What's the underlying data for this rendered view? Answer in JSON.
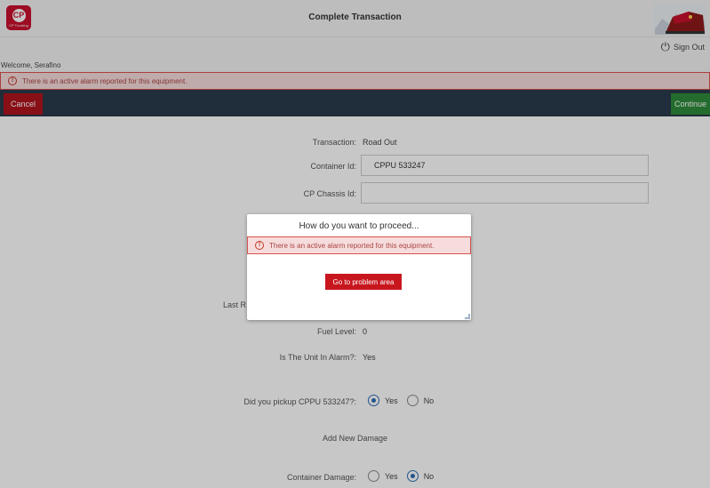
{
  "header": {
    "title": "Complete Transaction",
    "logo_text": "CP",
    "logo_subtext": "CP Trucking",
    "sign_out_label": "Sign Out"
  },
  "welcome_text": "Welcome, Serafino",
  "alert": {
    "message": "There is an active alarm reported for this equipment."
  },
  "actions": {
    "cancel_label": "Cancel",
    "continue_label": "Continue"
  },
  "form": {
    "transaction_label": "Transaction:",
    "transaction_value": "Road Out",
    "container_id_label": "Container Id:",
    "container_id_value": "CPPU 533247",
    "chassis_id_label": "CP Chassis Id:",
    "chassis_id_value": "",
    "last_partial_label": "Last R",
    "fuel_level_label": "Fuel Level:",
    "fuel_level_value": "0",
    "alarm_label": "Is The Unit In Alarm?:",
    "alarm_value": "Yes",
    "pickup_label": "Did you pickup CPPU 533247?:",
    "pickup_options": [
      "Yes",
      "No"
    ],
    "pickup_selected": "Yes",
    "add_damage_title": "Add New Damage",
    "container_damage_label": "Container Damage:",
    "container_damage_options": [
      "Yes",
      "No"
    ],
    "container_damage_selected": "No"
  },
  "modal": {
    "title": "How do you want to proceed...",
    "alert_message": "There is an active alarm reported for this equipment.",
    "button_label": "Go to problem area"
  },
  "colors": {
    "brand_red": "#c8102e",
    "action_bar": "#293a4b",
    "continue_green": "#2e8b3a",
    "alert_bg": "#f6dcdc",
    "alert_text": "#a94442"
  }
}
